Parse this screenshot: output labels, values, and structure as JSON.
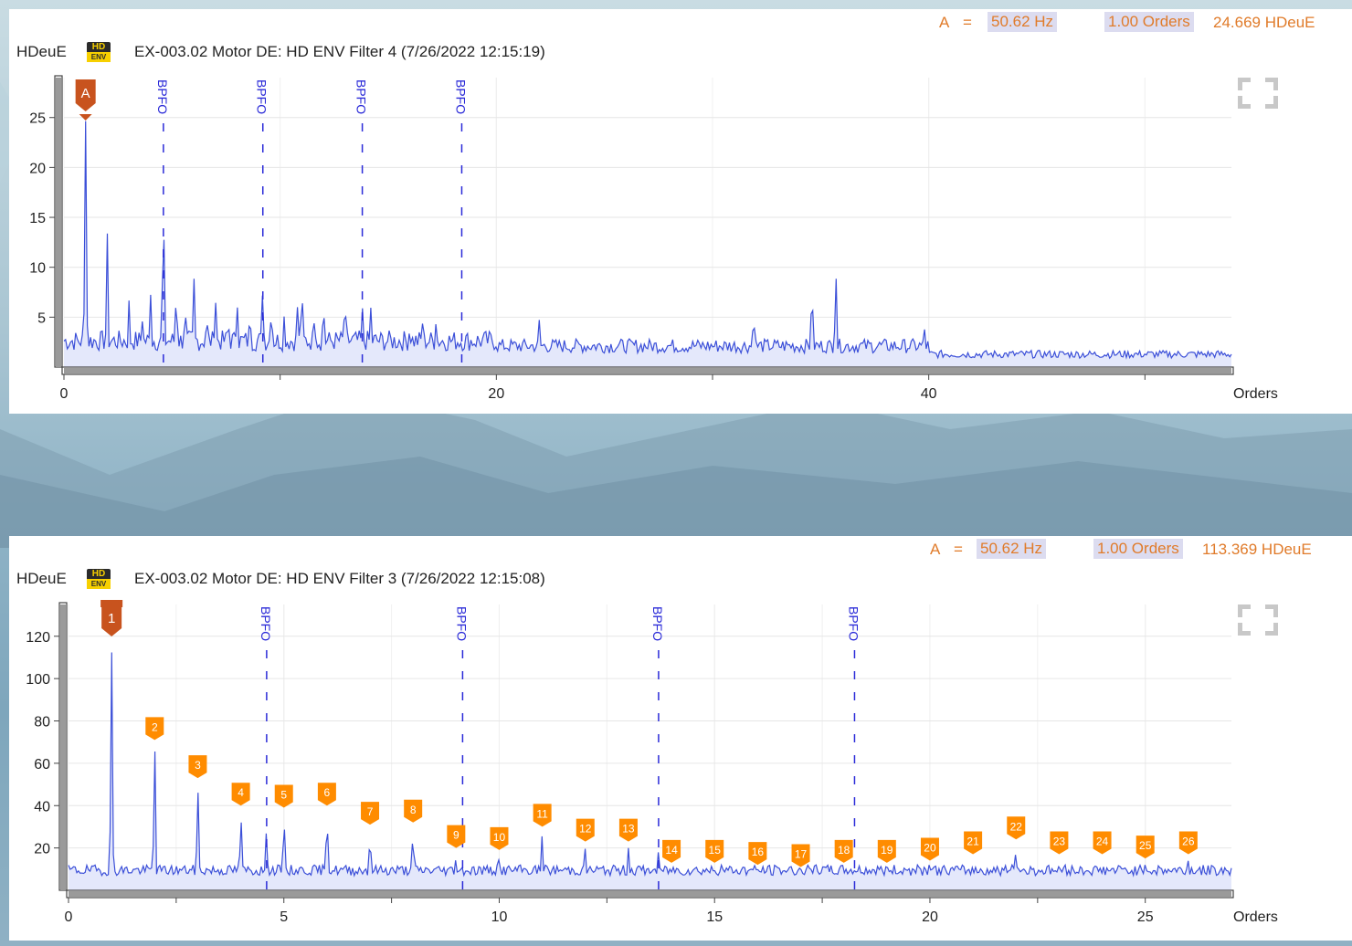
{
  "panels": [
    {
      "header": {
        "cursor_label": "A",
        "equals": "=",
        "frequency": "50.62 Hz",
        "orders": "1.00 Orders",
        "amplitude": "24.669 HDeuE"
      },
      "unit_label": "HDeuE",
      "badge_top": "HD",
      "badge_bottom": "ENV",
      "title": "EX-003.02  Motor DE: HD ENV Filter 4 (7/26/2022 12:15:19)",
      "x_axis_label": "Orders",
      "chart_data": {
        "type": "line",
        "title": "EX-003.02  Motor DE: HD ENV Filter 4 (7/26/2022 12:15:19)",
        "xlabel": "Orders",
        "ylabel": "HDeuE",
        "xlim": [
          0,
          54
        ],
        "ylim": [
          0,
          29
        ],
        "x_ticks": [
          0,
          20,
          40
        ],
        "y_ticks": [
          5,
          10,
          15,
          20,
          25
        ],
        "grid": true,
        "fault_markers": [
          {
            "label": "BPFO",
            "x": 4.6
          },
          {
            "label": "BPFO",
            "x": 9.2
          },
          {
            "label": "BPFO",
            "x": 13.8
          },
          {
            "label": "BPFO",
            "x": 18.4
          }
        ],
        "cursor": {
          "label": "A",
          "x": 1.0,
          "y": 24.669
        },
        "harmonic_markers": [],
        "base_level": 2.2,
        "noise_amplitude": 1.3,
        "noise_seed": 7,
        "peaks": [
          {
            "x": 1.0,
            "y": 24.7
          },
          {
            "x": 2.0,
            "y": 13.5
          },
          {
            "x": 3.0,
            "y": 6.8
          },
          {
            "x": 3.6,
            "y": 5.5
          },
          {
            "x": 4.0,
            "y": 7.5
          },
          {
            "x": 4.6,
            "y": 16.0
          },
          {
            "x": 5.2,
            "y": 7.8
          },
          {
            "x": 5.6,
            "y": 6.5
          },
          {
            "x": 6.0,
            "y": 9.6
          },
          {
            "x": 6.6,
            "y": 5.8
          },
          {
            "x": 7.0,
            "y": 7.2
          },
          {
            "x": 7.6,
            "y": 5.5
          },
          {
            "x": 8.0,
            "y": 6.9
          },
          {
            "x": 8.6,
            "y": 6.0
          },
          {
            "x": 9.2,
            "y": 8.0
          },
          {
            "x": 9.6,
            "y": 6.2
          },
          {
            "x": 10.2,
            "y": 5.5
          },
          {
            "x": 10.8,
            "y": 6.0
          },
          {
            "x": 11.0,
            "y": 8.4
          },
          {
            "x": 11.6,
            "y": 5.5
          },
          {
            "x": 12.0,
            "y": 6.8
          },
          {
            "x": 13.0,
            "y": 7.4
          },
          {
            "x": 13.8,
            "y": 6.0
          },
          {
            "x": 14.2,
            "y": 6.0
          },
          {
            "x": 16.0,
            "y": 4.4
          },
          {
            "x": 16.6,
            "y": 4.6
          },
          {
            "x": 17.2,
            "y": 4.3
          },
          {
            "x": 22.0,
            "y": 5.0
          },
          {
            "x": 31.9,
            "y": 5.7
          },
          {
            "x": 34.6,
            "y": 8.3
          },
          {
            "x": 35.7,
            "y": 9.6
          },
          {
            "x": 39.8,
            "y": 3.8
          }
        ]
      }
    },
    {
      "header": {
        "cursor_label": "A",
        "equals": "=",
        "frequency": "50.62 Hz",
        "orders": "1.00 Orders",
        "amplitude": "113.369 HDeuE"
      },
      "unit_label": "HDeuE",
      "badge_top": "HD",
      "badge_bottom": "ENV",
      "title": "EX-003.02  Motor DE: HD ENV Filter 3 (7/26/2022 12:15:08)",
      "x_axis_label": "Orders",
      "chart_data": {
        "type": "line",
        "title": "EX-003.02  Motor DE: HD ENV Filter 3 (7/26/2022 12:15:08)",
        "xlabel": "Orders",
        "ylabel": "HDeuE",
        "xlim": [
          0,
          27
        ],
        "ylim": [
          0,
          135
        ],
        "x_ticks": [
          0,
          5,
          10,
          15,
          20,
          25
        ],
        "y_ticks": [
          20,
          40,
          60,
          80,
          100,
          120
        ],
        "grid": true,
        "fault_markers": [
          {
            "label": "BPFO",
            "x": 4.6
          },
          {
            "label": "BPFO",
            "x": 9.15
          },
          {
            "label": "BPFO",
            "x": 13.7
          },
          {
            "label": "BPFO",
            "x": 18.25
          }
        ],
        "cursor": {
          "label": "1",
          "x": 1.0,
          "y": 113.369
        },
        "harmonic_markers": [
          {
            "label": "2",
            "x": 2.0,
            "y": 68
          },
          {
            "label": "3",
            "x": 3.0,
            "y": 50
          },
          {
            "label": "4",
            "x": 4.0,
            "y": 37
          },
          {
            "label": "5",
            "x": 5.0,
            "y": 36
          },
          {
            "label": "6",
            "x": 6.0,
            "y": 37
          },
          {
            "label": "7",
            "x": 7.0,
            "y": 28
          },
          {
            "label": "8",
            "x": 8.0,
            "y": 29
          },
          {
            "label": "9",
            "x": 9.0,
            "y": 17
          },
          {
            "label": "10",
            "x": 10.0,
            "y": 16
          },
          {
            "label": "11",
            "x": 11.0,
            "y": 27
          },
          {
            "label": "12",
            "x": 12.0,
            "y": 20
          },
          {
            "label": "13",
            "x": 13.0,
            "y": 20
          },
          {
            "label": "14",
            "x": 14.0,
            "y": 10
          },
          {
            "label": "15",
            "x": 15.0,
            "y": 10
          },
          {
            "label": "16",
            "x": 16.0,
            "y": 9
          },
          {
            "label": "17",
            "x": 17.0,
            "y": 8
          },
          {
            "label": "18",
            "x": 18.0,
            "y": 10
          },
          {
            "label": "19",
            "x": 19.0,
            "y": 10
          },
          {
            "label": "20",
            "x": 20.0,
            "y": 11
          },
          {
            "label": "21",
            "x": 21.0,
            "y": 14
          },
          {
            "label": "22",
            "x": 22.0,
            "y": 21
          },
          {
            "label": "23",
            "x": 23.0,
            "y": 14
          },
          {
            "label": "24",
            "x": 24.0,
            "y": 14
          },
          {
            "label": "25",
            "x": 25.0,
            "y": 12
          },
          {
            "label": "26",
            "x": 26.0,
            "y": 14
          }
        ],
        "base_level": 9,
        "noise_amplitude": 5,
        "noise_seed": 19,
        "peaks": [
          {
            "x": 1.0,
            "y": 113.4
          },
          {
            "x": 2.0,
            "y": 68
          },
          {
            "x": 3.0,
            "y": 50
          },
          {
            "x": 4.0,
            "y": 37
          },
          {
            "x": 4.6,
            "y": 30
          },
          {
            "x": 5.0,
            "y": 36
          },
          {
            "x": 6.0,
            "y": 37
          },
          {
            "x": 7.0,
            "y": 28
          },
          {
            "x": 8.0,
            "y": 29
          },
          {
            "x": 9.0,
            "y": 17
          },
          {
            "x": 10.0,
            "y": 16
          },
          {
            "x": 11.0,
            "y": 27
          },
          {
            "x": 12.0,
            "y": 20
          },
          {
            "x": 13.0,
            "y": 20
          },
          {
            "x": 13.7,
            "y": 19
          },
          {
            "x": 22.0,
            "y": 21
          },
          {
            "x": 26.0,
            "y": 14
          }
        ]
      }
    }
  ],
  "colors": {
    "signal": "#3b4fd8",
    "signal_fill": "#e4e8fb",
    "cursor": "#c8531e",
    "harmonic": "#ff8c00",
    "fault": "#2a2ad8",
    "grid": "#e6e6e6",
    "axis_text": "#222222"
  }
}
